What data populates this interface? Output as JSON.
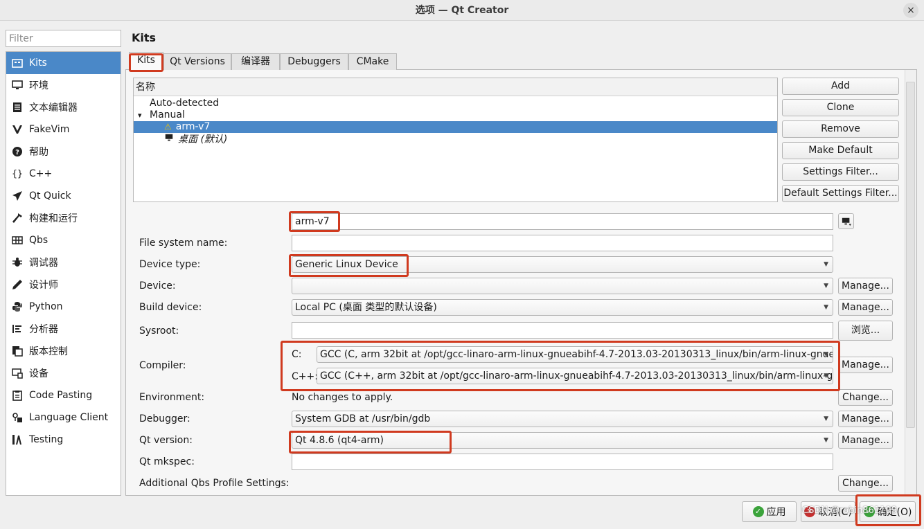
{
  "window": {
    "title": "选项 — Qt Creator",
    "close_glyph": "×"
  },
  "filter": {
    "placeholder": "Filter",
    "value": ""
  },
  "sidebar": {
    "items": [
      {
        "label": "Kits",
        "icon": "kits-icon",
        "selected": true
      },
      {
        "label": "环境",
        "icon": "monitor-icon"
      },
      {
        "label": "文本编辑器",
        "icon": "text-editor-icon"
      },
      {
        "label": "FakeVim",
        "icon": "fakevim-icon"
      },
      {
        "label": "帮助",
        "icon": "help-icon"
      },
      {
        "label": "C++",
        "icon": "braces-icon"
      },
      {
        "label": "Qt Quick",
        "icon": "paper-plane-icon"
      },
      {
        "label": "构建和运行",
        "icon": "hammer-icon"
      },
      {
        "label": "Qbs",
        "icon": "grid-icon"
      },
      {
        "label": "调试器",
        "icon": "bug-icon"
      },
      {
        "label": "设计师",
        "icon": "pen-icon"
      },
      {
        "label": "Python",
        "icon": "python-icon"
      },
      {
        "label": "分析器",
        "icon": "analyzer-icon"
      },
      {
        "label": "版本控制",
        "icon": "version-control-icon"
      },
      {
        "label": "设备",
        "icon": "device-icon"
      },
      {
        "label": "Code Pasting",
        "icon": "clipboard-icon"
      },
      {
        "label": "Language Client",
        "icon": "language-client-icon"
      },
      {
        "label": "Testing",
        "icon": "testing-icon"
      }
    ]
  },
  "page": {
    "title": "Kits"
  },
  "tabs": [
    {
      "label": "Kits",
      "selected": true
    },
    {
      "label": "Qt Versions"
    },
    {
      "label": "编译器"
    },
    {
      "label": "Debuggers"
    },
    {
      "label": "CMake"
    }
  ],
  "tree": {
    "header": "名称",
    "rows": [
      {
        "label": "Auto-detected"
      },
      {
        "label": "Manual",
        "expander": "▾"
      },
      {
        "label": "arm-v7",
        "selected": true,
        "icon": "warning-icon",
        "icon_glyph": "⚠"
      },
      {
        "label": "桌面 (默认)",
        "icon": "desktop-icon",
        "italic": true
      }
    ]
  },
  "kit_buttons": [
    "Add",
    "Clone",
    "Remove",
    "Make Default",
    "Settings Filter...",
    "Default Settings Filter..."
  ],
  "form": {
    "name_value": "arm-v7",
    "filesystem_label": "File system name:",
    "filesystem_value": "",
    "device_type_label": "Device type:",
    "device_type_value": "Generic Linux Device",
    "device_label": "Device:",
    "device_value": "",
    "build_device_label": "Build device:",
    "build_device_value": "Local PC (桌面 类型的默认设备)",
    "sysroot_label": "Sysroot:",
    "sysroot_value": "",
    "browse_label": "浏览...",
    "compiler_label": "Compiler:",
    "c_label": "C:",
    "c_value": "GCC (C, arm 32bit at /opt/gcc-linaro-arm-linux-gnueabihf-4.7-2013.03-20130313_linux/bin/arm-linux-gnuea",
    "cpp_label": "C++:",
    "cpp_value": "GCC (C++, arm 32bit at /opt/gcc-linaro-arm-linux-gnueabihf-4.7-2013.03-20130313_linux/bin/arm-linux-gnu",
    "environment_label": "Environment:",
    "environment_value": "No changes to apply.",
    "debugger_label": "Debugger:",
    "debugger_value": "System GDB at /usr/bin/gdb",
    "qt_version_label": "Qt version:",
    "qt_version_value": "Qt 4.8.6 (qt4-arm)",
    "qt_mkspec_label": "Qt mkspec:",
    "qt_mkspec_value": "",
    "qbs_label": "Additional Qbs Profile Settings:",
    "manage_label": "Manage...",
    "change_label": "Change...",
    "combo_arrow": "▼"
  },
  "bottom": {
    "apply": "应用",
    "cancel": "取消(C)",
    "ok": "确定(O)",
    "apply_glyph": "✓",
    "cancel_glyph": "✕",
    "ok_glyph": "✓"
  },
  "watermark": "CSDN @robin861109",
  "colors": {
    "selection": "#4a88c8",
    "highlight_box": "#d03a1f"
  }
}
